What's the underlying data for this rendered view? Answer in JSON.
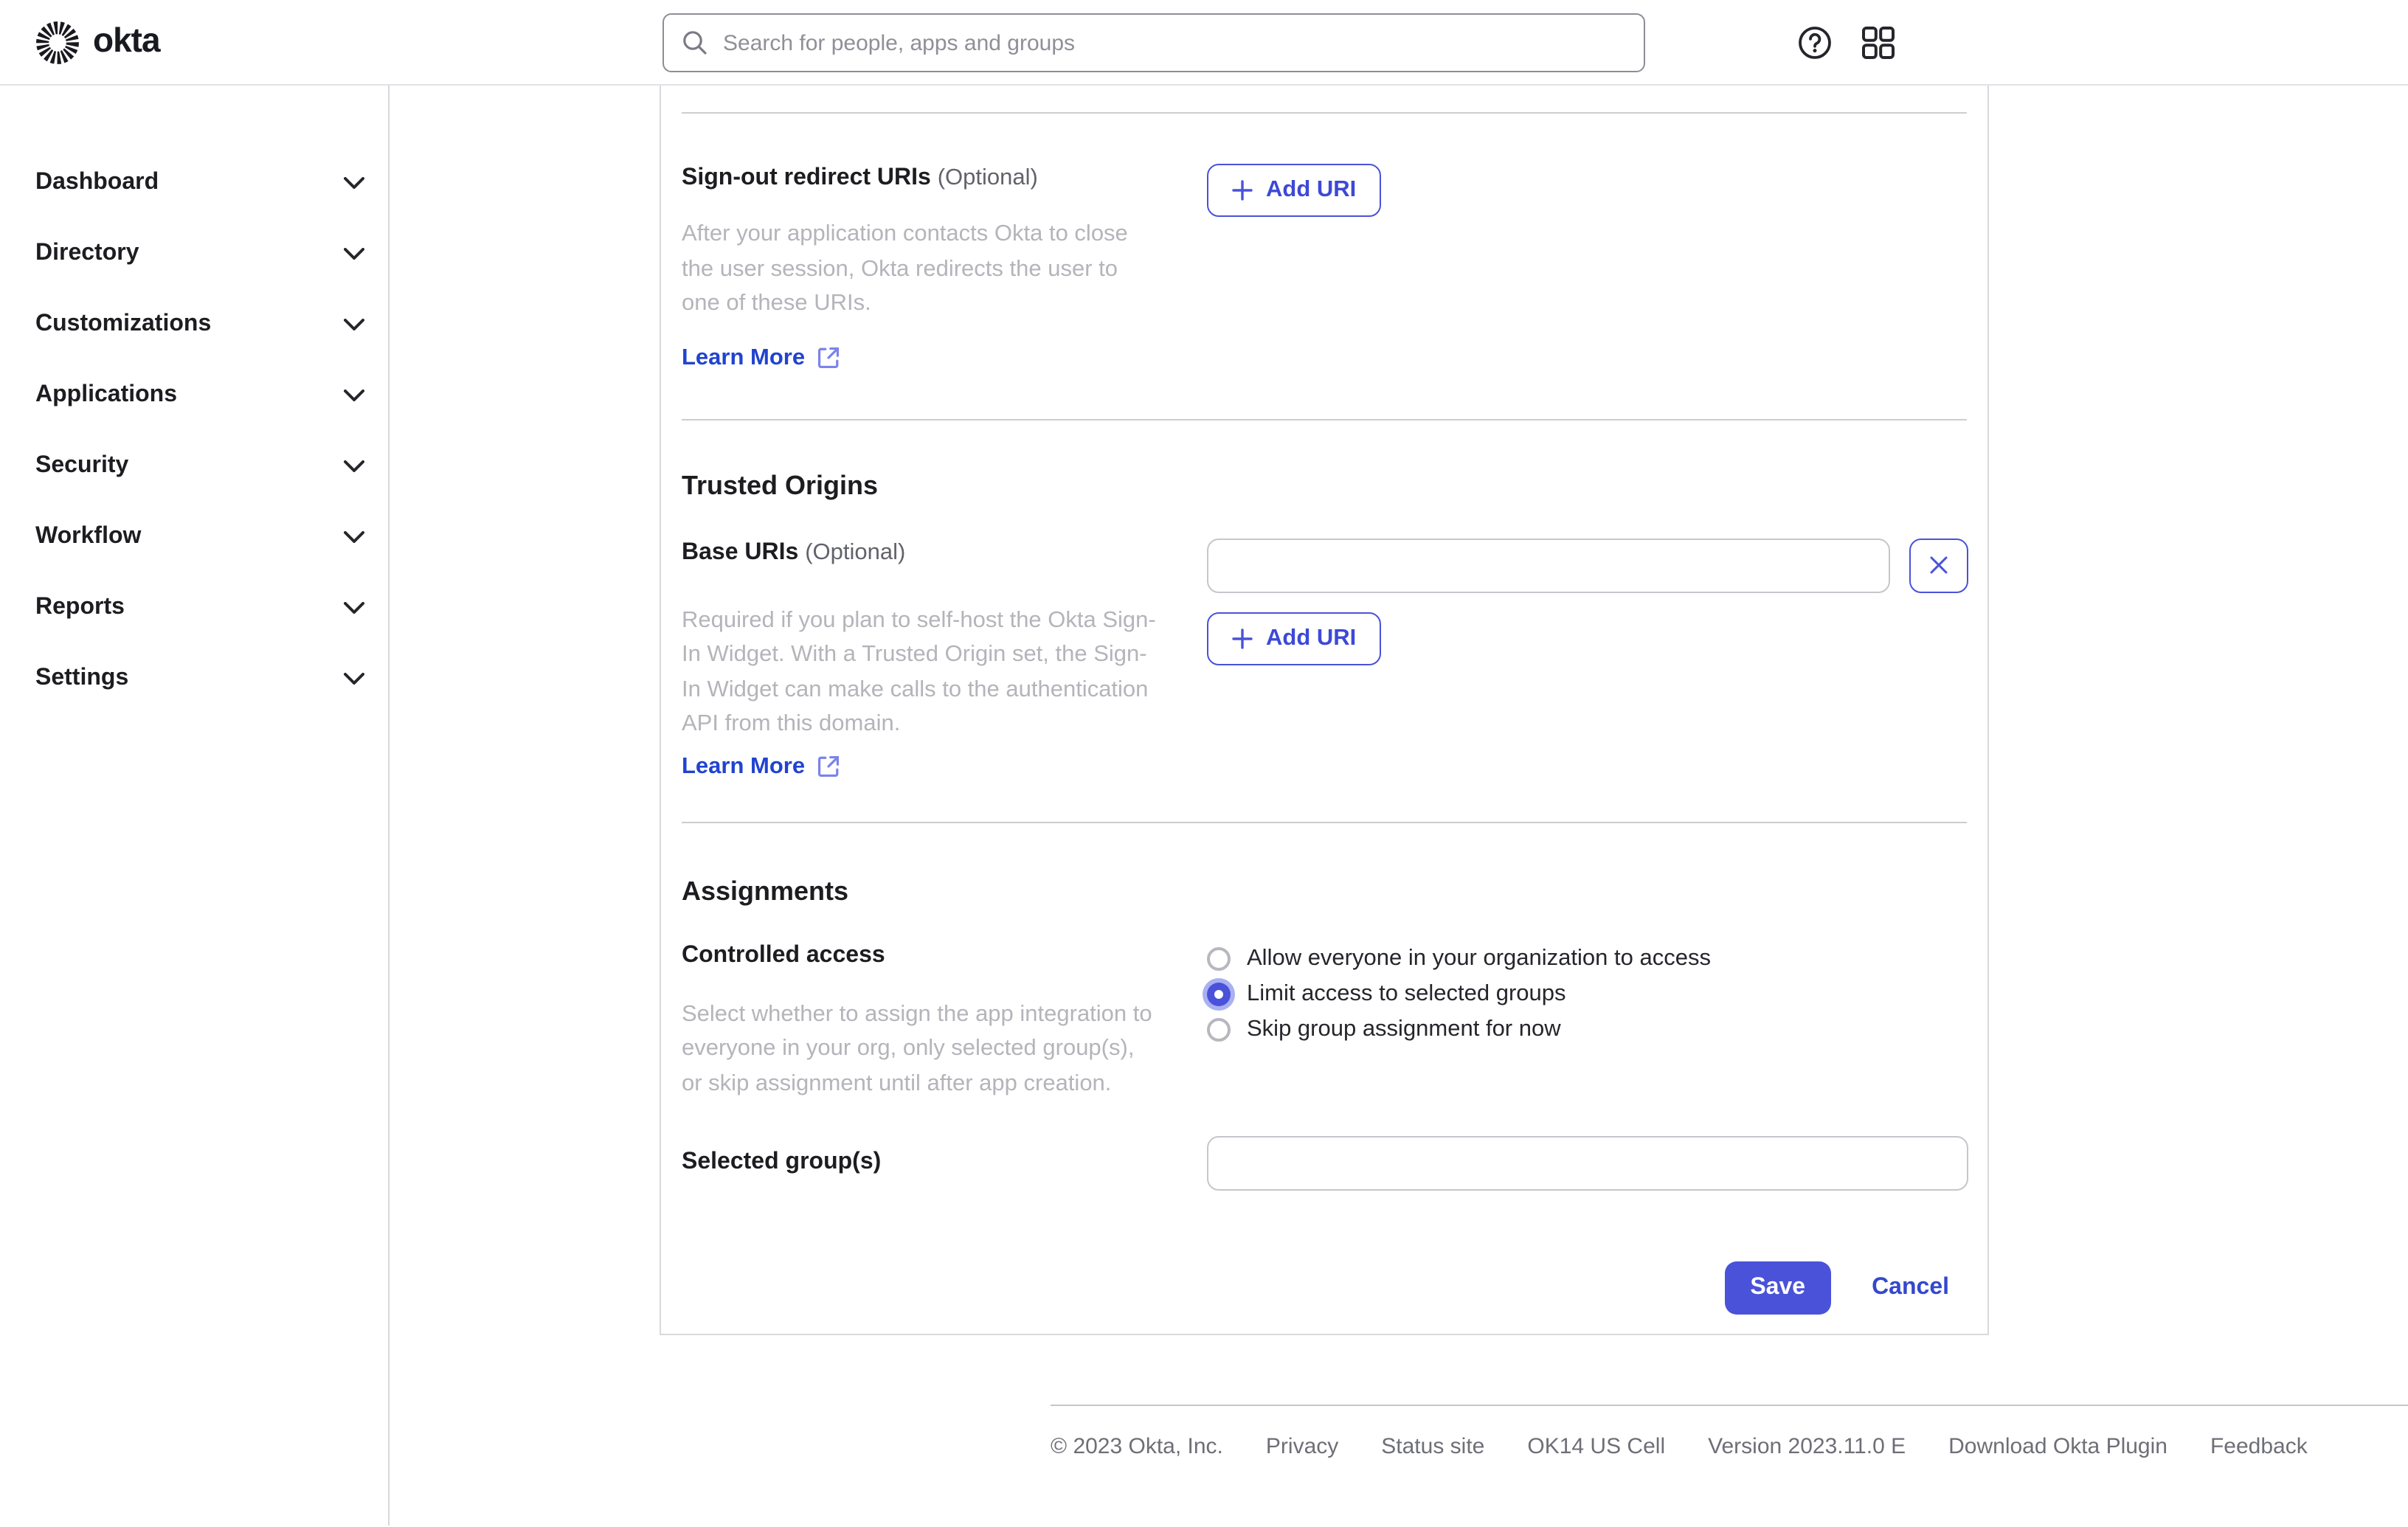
{
  "header": {
    "brand": "okta",
    "search": {
      "placeholder": "Search for people, apps and groups",
      "value": ""
    }
  },
  "sidebar": {
    "items": [
      {
        "label": "Dashboard"
      },
      {
        "label": "Directory"
      },
      {
        "label": "Customizations"
      },
      {
        "label": "Applications"
      },
      {
        "label": "Security"
      },
      {
        "label": "Workflow"
      },
      {
        "label": "Reports"
      },
      {
        "label": "Settings"
      }
    ]
  },
  "form": {
    "signout_redirect": {
      "label": "Sign-out redirect URIs",
      "optional": "(Optional)",
      "description": "After your application contacts Okta to close the user session, Okta redirects the user to one of these URIs.",
      "learn_more": "Learn More",
      "add_uri_label": "Add URI"
    },
    "trusted_origins": {
      "heading": "Trusted Origins",
      "base_uris": {
        "label": "Base URIs",
        "optional": "(Optional)",
        "value": "",
        "description": "Required if you plan to self-host the Okta Sign-In Widget. With a Trusted Origin set, the Sign-In Widget can make calls to the authentication API from this domain.",
        "learn_more": "Learn More",
        "add_uri_label": "Add URI"
      }
    },
    "assignments": {
      "heading": "Assignments",
      "controlled_access": {
        "label": "Controlled access",
        "description": "Select whether to assign the app integration to everyone in your org, only selected group(s), or skip assignment until after app creation.",
        "options": [
          {
            "label": "Allow everyone in your organization to access",
            "checked": false
          },
          {
            "label": "Limit access to selected groups",
            "checked": true
          },
          {
            "label": "Skip group assignment for now",
            "checked": false
          }
        ]
      },
      "selected_groups": {
        "label": "Selected group(s)",
        "value": ""
      }
    },
    "actions": {
      "save": "Save",
      "cancel": "Cancel"
    }
  },
  "footer": {
    "links": [
      "© 2023 Okta, Inc.",
      "Privacy",
      "Status site",
      "OK14 US Cell",
      "Version 2023.11.0 E",
      "Download Okta Plugin",
      "Feedback"
    ]
  },
  "colors": {
    "accent": "#4a52d9",
    "link": "#2143cf",
    "text": "#1d1d21",
    "muted": "#6e6e78",
    "faint": "#b4b4ba"
  }
}
